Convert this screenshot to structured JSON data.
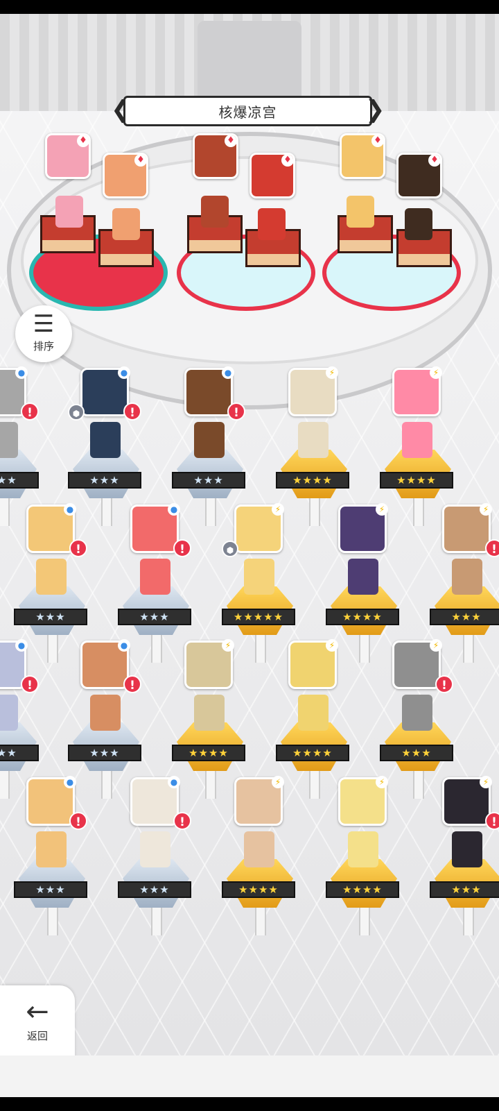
{
  "header": {
    "title": "核爆凉宫"
  },
  "sort_button": {
    "label": "排序",
    "icon": "sort-icon"
  },
  "back_button": {
    "label": "返回",
    "icon": "arrow-left-icon"
  },
  "team": [
    {
      "name": "slot-1",
      "color": "#f4a2b5"
    },
    {
      "name": "slot-2",
      "color": "#f0a070"
    },
    {
      "name": "slot-3",
      "color": "#b2462d"
    },
    {
      "name": "slot-4",
      "color": "#d43b30"
    },
    {
      "name": "slot-5",
      "color": "#f3c46a"
    },
    {
      "name": "slot-6",
      "color": "#3f2c20"
    }
  ],
  "units": [
    {
      "stars": "★★★",
      "tier": "silver",
      "alert": true,
      "shield": false,
      "color": "#a6a6a6"
    },
    {
      "stars": "★★★",
      "tier": "silver",
      "alert": true,
      "shield": true,
      "color": "#2b3e5a"
    },
    {
      "stars": "★★★",
      "tier": "silver",
      "alert": true,
      "shield": false,
      "color": "#7a4a2a"
    },
    {
      "stars": "★★★★",
      "tier": "gold",
      "alert": false,
      "shield": false,
      "color": "#e8dcc2"
    },
    {
      "stars": "★★★★",
      "tier": "gold",
      "alert": false,
      "shield": false,
      "color": "#ff8aa6"
    },
    {
      "stars": "★★★",
      "tier": "silver",
      "alert": true,
      "shield": false,
      "color": "#f3c777"
    },
    {
      "stars": "★★★",
      "tier": "silver",
      "alert": true,
      "shield": false,
      "color": "#f26a6a"
    },
    {
      "stars": "★★★★★",
      "tier": "gold",
      "alert": false,
      "shield": true,
      "color": "#f5d37a"
    },
    {
      "stars": "★★★★",
      "tier": "gold",
      "alert": false,
      "shield": false,
      "color": "#4e3d73"
    },
    {
      "stars": "★★★",
      "tier": "gold",
      "alert": true,
      "shield": false,
      "color": "#c89a73"
    },
    {
      "stars": "★★★",
      "tier": "silver",
      "alert": true,
      "shield": false,
      "color": "#b9bfdc"
    },
    {
      "stars": "★★★",
      "tier": "silver",
      "alert": true,
      "shield": false,
      "color": "#d78e62"
    },
    {
      "stars": "★★★★",
      "tier": "gold",
      "alert": false,
      "shield": false,
      "color": "#d8c79a"
    },
    {
      "stars": "★★★★",
      "tier": "gold",
      "alert": false,
      "shield": false,
      "color": "#f0d36f"
    },
    {
      "stars": "★★★",
      "tier": "gold",
      "alert": true,
      "shield": false,
      "color": "#8f8f8f"
    },
    {
      "stars": "★★★",
      "tier": "silver",
      "alert": true,
      "shield": false,
      "color": "#f2c27a"
    },
    {
      "stars": "★★★",
      "tier": "silver",
      "alert": true,
      "shield": false,
      "color": "#eee7db"
    },
    {
      "stars": "★★★★",
      "tier": "gold",
      "alert": false,
      "shield": false,
      "color": "#e6c2a0"
    },
    {
      "stars": "★★★★",
      "tier": "gold",
      "alert": false,
      "shield": false,
      "color": "#f4e08a"
    },
    {
      "stars": "★★★",
      "tier": "gold",
      "alert": true,
      "shield": false,
      "color": "#2b2730"
    }
  ]
}
